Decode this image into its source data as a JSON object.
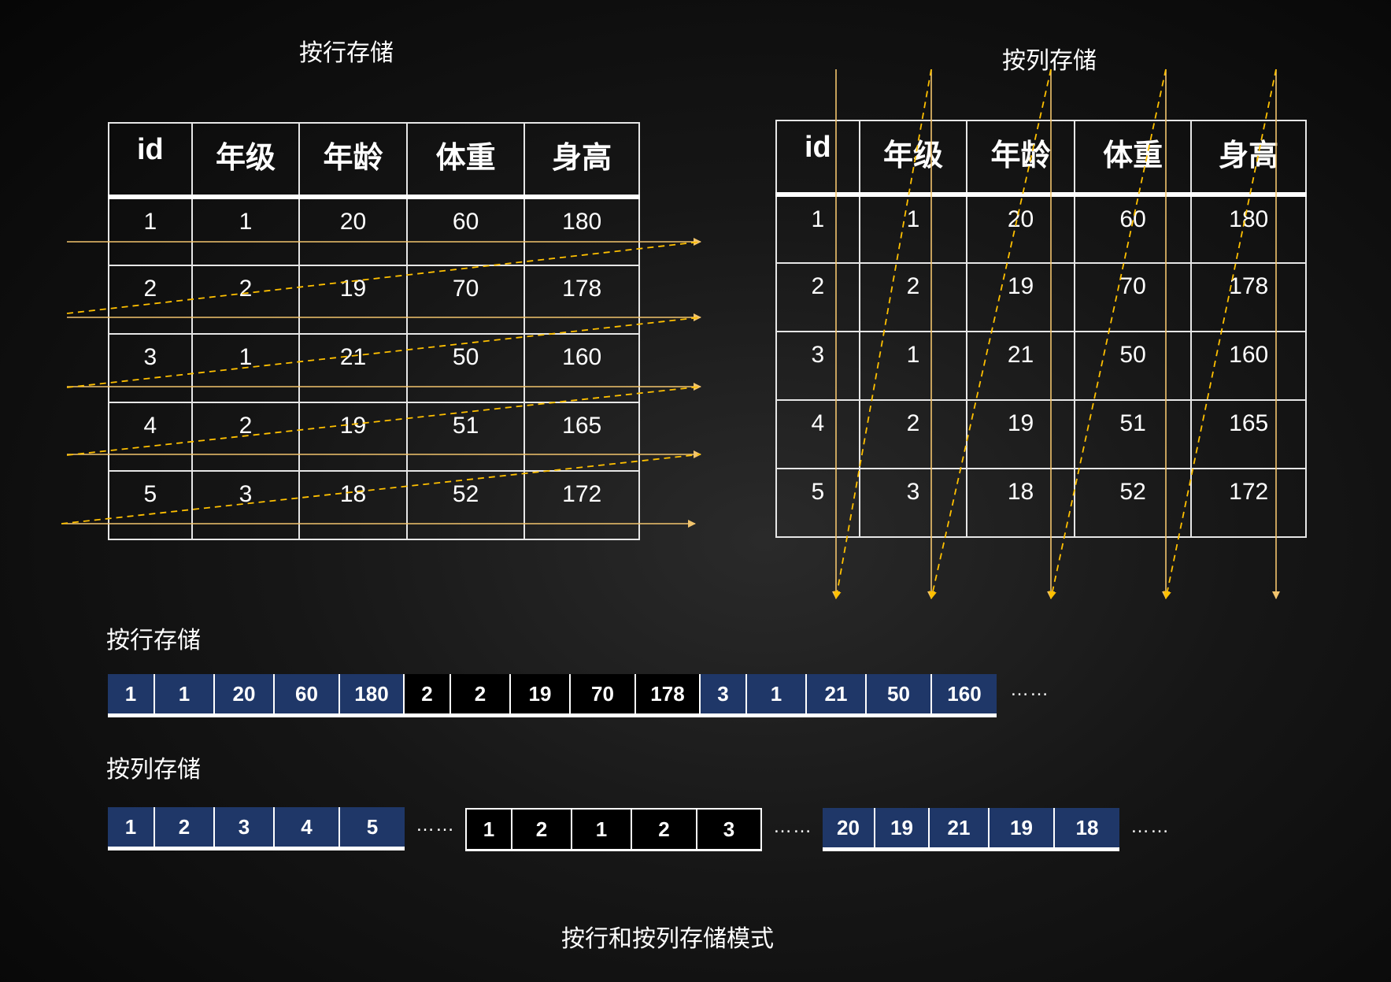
{
  "titles": {
    "row_table": "按行存储",
    "col_table": "按列存储",
    "row_strip": "按行存储",
    "col_strip": "按列存储",
    "caption": "按行和按列存储模式"
  },
  "table": {
    "headers": [
      "id",
      "年级",
      "年龄",
      "体重",
      "身高"
    ],
    "rows": [
      [
        "1",
        "1",
        "20",
        "60",
        "180"
      ],
      [
        "2",
        "2",
        "19",
        "70",
        "178"
      ],
      [
        "3",
        "1",
        "21",
        "50",
        "160"
      ],
      [
        "4",
        "2",
        "19",
        "51",
        "165"
      ],
      [
        "5",
        "3",
        "18",
        "52",
        "172"
      ]
    ]
  },
  "row_storage": {
    "cells": [
      "1",
      "1",
      "20",
      "60",
      "180",
      "2",
      "2",
      "19",
      "70",
      "178",
      "3",
      "1",
      "21",
      "50",
      "160"
    ],
    "ellipsis": "……"
  },
  "col_storage": {
    "group1": [
      "1",
      "2",
      "3",
      "4",
      "5"
    ],
    "group2": [
      "1",
      "2",
      "1",
      "2",
      "3"
    ],
    "group3": [
      "20",
      "19",
      "21",
      "19",
      "18"
    ],
    "ellipsis": "……"
  },
  "colors": {
    "block_blue": "#1f3768",
    "block_black": "#000000",
    "arrow_yellow": "#ffc000",
    "arrow_tan": "#f2c46d"
  }
}
